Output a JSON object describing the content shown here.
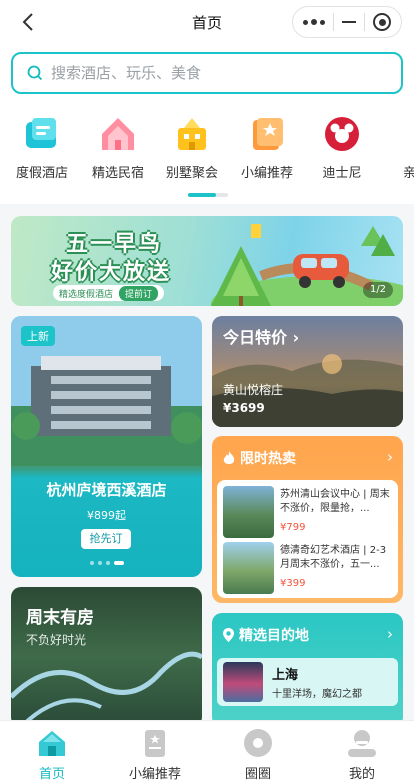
{
  "nav": {
    "title": "首页"
  },
  "search": {
    "placeholder": "搜索酒店、玩乐、美食"
  },
  "categories": [
    {
      "label": "度假酒店",
      "icon": "hotel-icon",
      "color": "#1ec3d8"
    },
    {
      "label": "精选民宿",
      "icon": "house-icon",
      "color": "#ff8fa0"
    },
    {
      "label": "别墅聚会",
      "icon": "villa-icon",
      "color": "#ffc21c"
    },
    {
      "label": "小编推荐",
      "icon": "editor-icon",
      "color": "#ff9a3c"
    },
    {
      "label": "迪士尼",
      "icon": "disney-icon",
      "color": "#d6203a"
    },
    {
      "label": "亲子",
      "icon": "parent-child-icon",
      "color": "#1cc3e0"
    }
  ],
  "banner": {
    "line1": "五一早鸟",
    "line2": "好价大放送",
    "pill_text": "精选度假酒店",
    "pill_button": "提前订",
    "page": "1/2"
  },
  "featured": {
    "tag": "上新",
    "name": "杭州庐境西溪酒店",
    "price": "¥899起",
    "button": "抢先订"
  },
  "today_deal": {
    "heading": "今日特价",
    "name": "黄山悦榕庄",
    "price": "¥3699"
  },
  "hot_sale": {
    "heading": "限时热卖",
    "items": [
      {
        "text": "苏州清山会议中心 | 周末不涨价，限量抢，...",
        "price": "¥799"
      },
      {
        "text": "德清奇幻艺术酒店 | 2-3月周末不涨价，五一...",
        "price": "¥399"
      }
    ]
  },
  "weekend": {
    "title": "周末有房",
    "subtitle": "不负好时光"
  },
  "destinations": {
    "heading": "精选目的地",
    "items": [
      {
        "city": "上海",
        "desc": "十里洋场，魔幻之都"
      }
    ]
  },
  "tabbar": [
    {
      "label": "首页",
      "icon": "home-icon",
      "active": true
    },
    {
      "label": "小编推荐",
      "icon": "editor-note-icon",
      "active": false
    },
    {
      "label": "圈圈",
      "icon": "circle-icon",
      "active": false
    },
    {
      "label": "我的",
      "icon": "user-icon",
      "active": false
    }
  ]
}
